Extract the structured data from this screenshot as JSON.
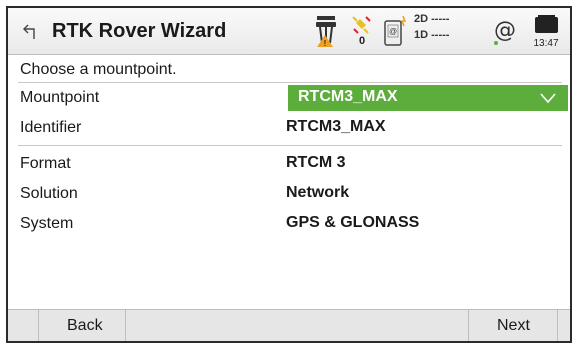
{
  "header": {
    "title": "RTK Rover Wizard",
    "satellite_count": "0",
    "position_2d": "2D -----",
    "position_1d": "1D -----",
    "clock": "13:47"
  },
  "prompt": "Choose a mountpoint.",
  "fields": {
    "mountpoint_label": "Mountpoint",
    "mountpoint_value": "RTCM3_MAX",
    "identifier_label": "Identifier",
    "identifier_value": "RTCM3_MAX",
    "format_label": "Format",
    "format_value": "RTCM 3",
    "solution_label": "Solution",
    "solution_value": "Network",
    "system_label": "System",
    "system_value": "GPS & GLONASS"
  },
  "footer": {
    "back_label": "Back",
    "next_label": "Next"
  },
  "colors": {
    "accent": "#5cad3c",
    "warning": "#f0a020",
    "satellite": "#e8c020"
  }
}
